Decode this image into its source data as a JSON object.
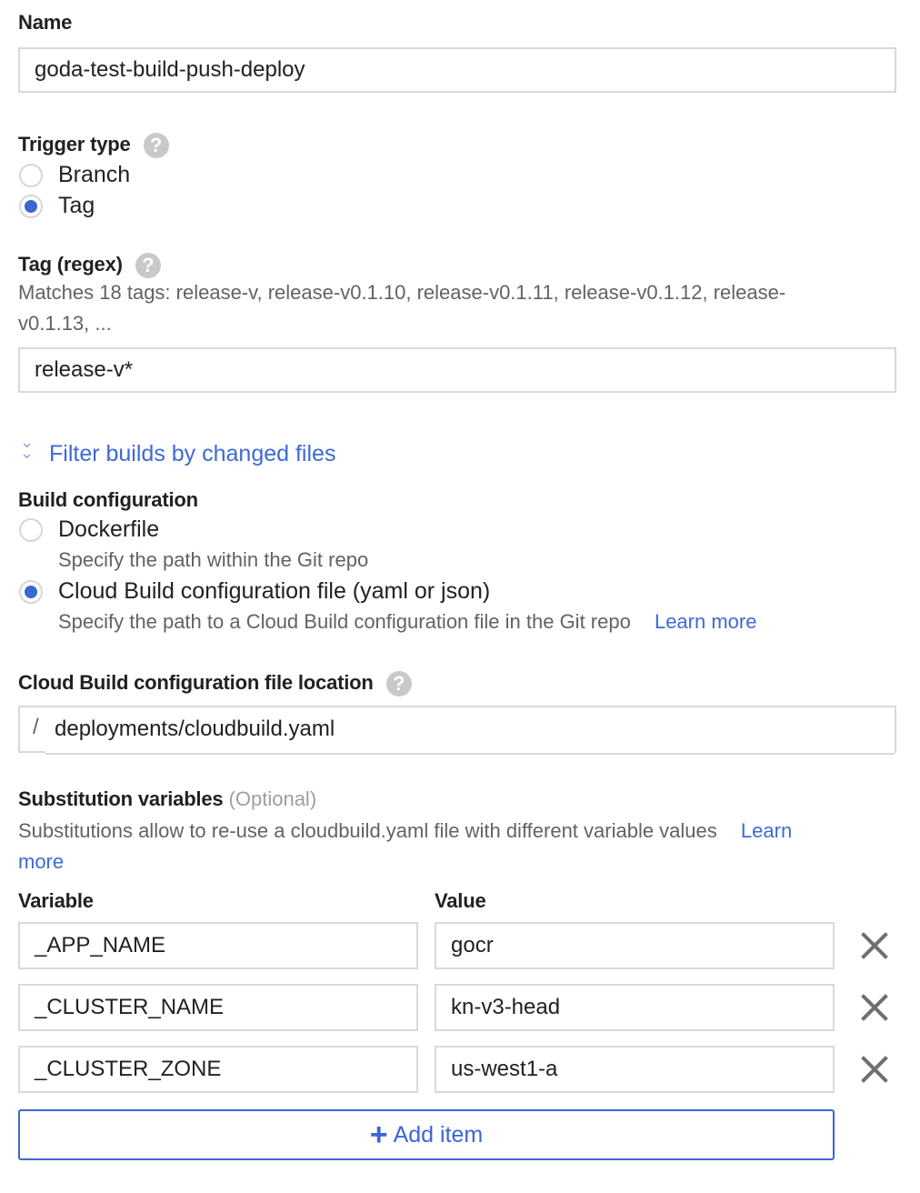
{
  "name": {
    "label": "Name",
    "value": "goda-test-build-push-deploy"
  },
  "trigger_type": {
    "label": "Trigger type",
    "help_icon": "help-icon",
    "options": [
      {
        "label": "Branch",
        "selected": false
      },
      {
        "label": "Tag",
        "selected": true
      }
    ]
  },
  "tag_regex": {
    "label": "Tag (regex)",
    "help_icon": "help-icon",
    "matches_line1": "Matches 18 tags: release-v, release-v0.1.10, release-v0.1.11, release-v0.1.12, release-",
    "matches_line2": "v0.1.13, ...",
    "value": "release-v*"
  },
  "filter_link": {
    "label": "Filter builds by changed files",
    "icon": "double-chevron-down-icon"
  },
  "build_config": {
    "label": "Build configuration",
    "options": [
      {
        "label": "Dockerfile",
        "description": "Specify the path within the Git repo",
        "selected": false
      },
      {
        "label": "Cloud Build configuration file (yaml or json)",
        "description": "Specify the path to a Cloud Build configuration file in the Git repo",
        "learn_more": "Learn more",
        "selected": true
      }
    ]
  },
  "config_location": {
    "label": "Cloud Build configuration file location",
    "prefix": "/",
    "value": "deployments/cloudbuild.yaml"
  },
  "substitutions": {
    "label": "Substitution variables",
    "optional": "(Optional)",
    "description": "Substitutions allow to re-use a cloudbuild.yaml file with different variable values",
    "learn_more_1": "Learn",
    "learn_more_2": "more",
    "col_variable": "Variable",
    "col_value": "Value",
    "rows": [
      {
        "variable": "_APP_NAME",
        "value": "gocr"
      },
      {
        "variable": "_CLUSTER_NAME",
        "value": "kn-v3-head"
      },
      {
        "variable": "_CLUSTER_ZONE",
        "value": "us-west1-a"
      }
    ],
    "add_item": "Add item",
    "add_icon": "+"
  },
  "colors": {
    "accent": "#3b66d4",
    "link": "#3d6ad6",
    "muted": "#5f6368",
    "border": "#d9d9d9"
  }
}
